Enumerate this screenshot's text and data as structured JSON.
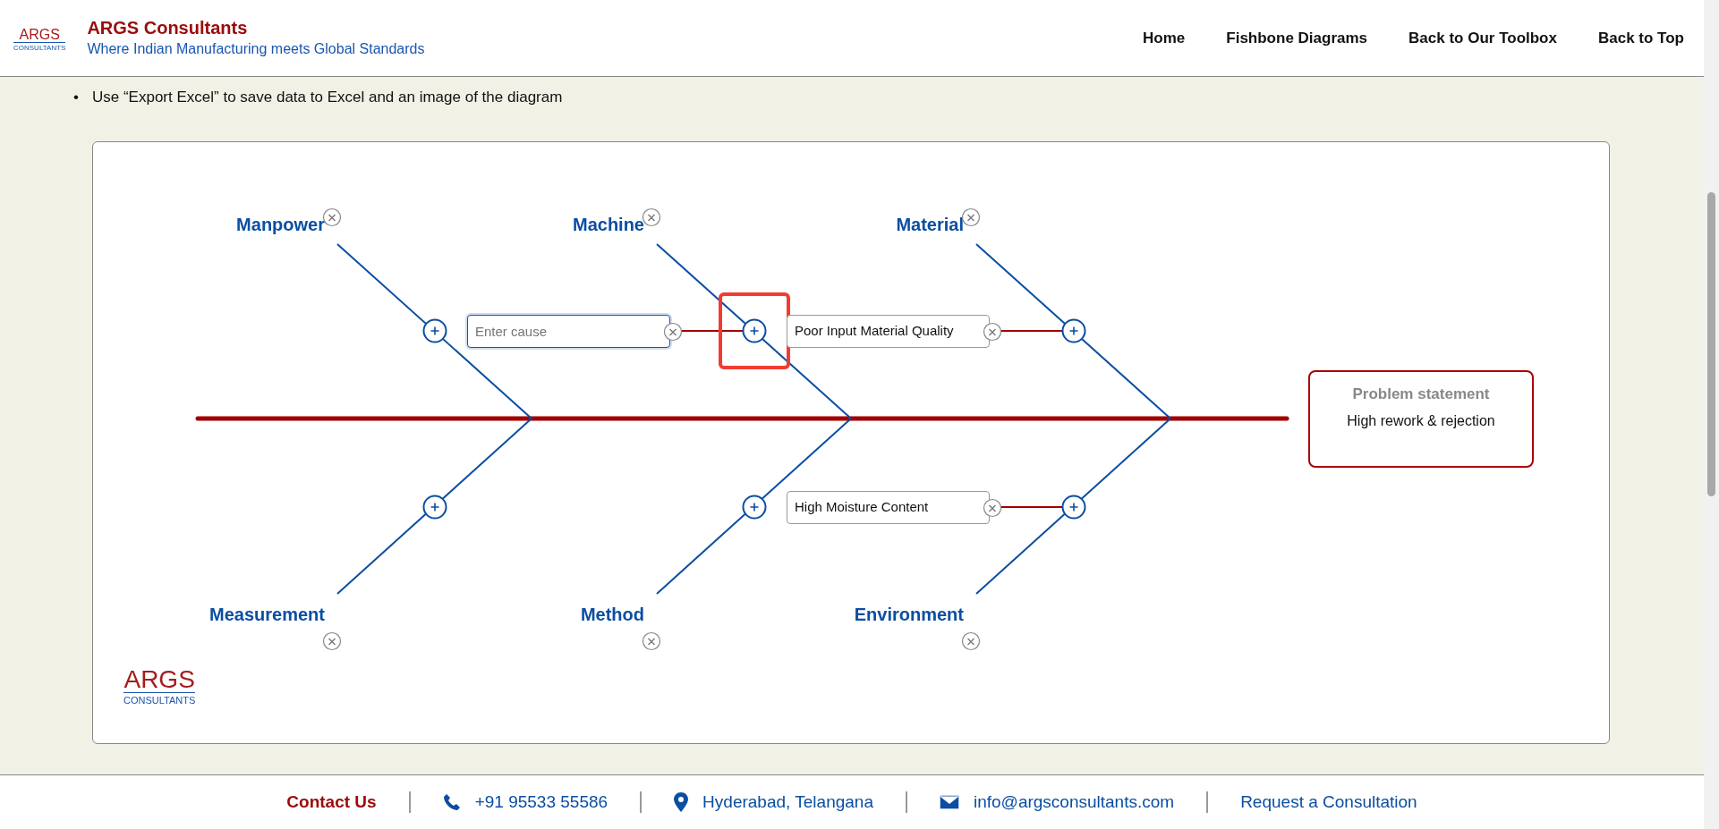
{
  "header": {
    "logo": {
      "name": "ARGS",
      "subtitle": "CONSULTANTS"
    },
    "title": "ARGS Consultants",
    "tagline": "Where Indian Manufacturing meets Global Standards",
    "nav": [
      {
        "label": "Home"
      },
      {
        "label": "Fishbone Diagrams"
      },
      {
        "label": "Back to Our Toolbox"
      },
      {
        "label": "Back to Top"
      }
    ]
  },
  "instructions": [
    {
      "marker": "•",
      "text": "Use “Export Excel” to save data to Excel and an image of the diagram"
    }
  ],
  "diagram": {
    "categories": [
      {
        "name": "Manpower",
        "highlighted": false
      },
      {
        "name": "Machine",
        "highlighted": true,
        "causes": [
          {
            "kind": "input",
            "placeholder": "Enter cause",
            "focused": true
          }
        ]
      },
      {
        "name": "Material",
        "highlighted": false,
        "causes": [
          {
            "kind": "text",
            "text": "Poor Input Material Quality"
          }
        ]
      },
      {
        "name": "Measurement",
        "highlighted": false
      },
      {
        "name": "Method",
        "highlighted": false
      },
      {
        "name": "Environment",
        "highlighted": false,
        "causes": [
          {
            "kind": "text",
            "text": "High Moisture Content"
          }
        ]
      }
    ],
    "problem": {
      "title": "Problem statement",
      "text": "High rework & rejection"
    },
    "logo": {
      "name": "ARGS",
      "subtitle": "CONSULTANTS"
    }
  },
  "footer": {
    "contact_label": "Contact Us",
    "items": [
      {
        "kind": "phone",
        "text": "+91 95533 55586"
      },
      {
        "kind": "location",
        "text": "Hyderabad, Telangana"
      },
      {
        "kind": "email",
        "text": "info@argsconsultants.com"
      },
      {
        "kind": "link",
        "text": "Request a Consultation"
      }
    ]
  }
}
